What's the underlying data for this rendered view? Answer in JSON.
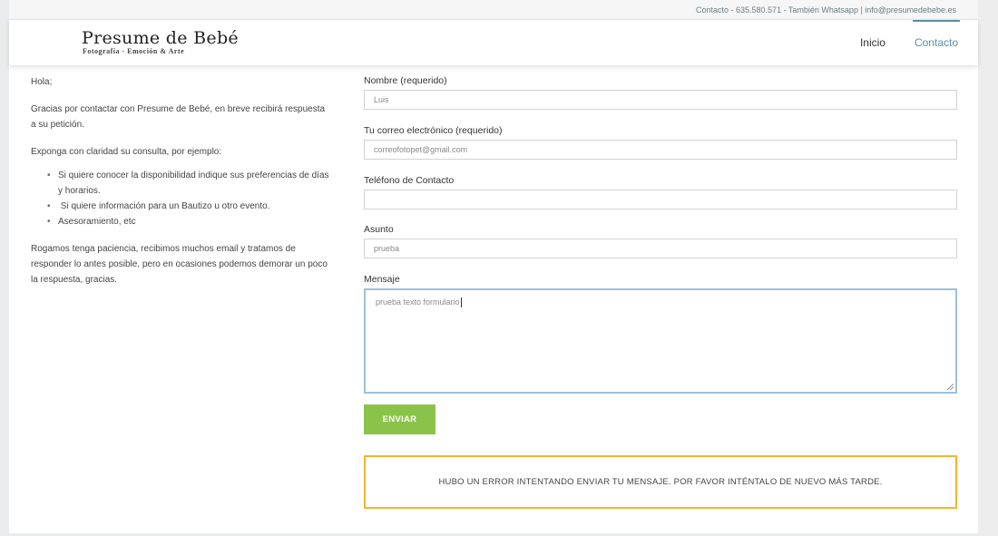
{
  "topbar": {
    "text": "Contacto - 635.580.571 - También Whatsapp  |  info@presumedebebe.es"
  },
  "header": {
    "logo_title": "Presume de Bebé",
    "logo_subtitle": "Fotografía - Emoción & Arte",
    "nav": [
      {
        "label": "Inicio",
        "active": false
      },
      {
        "label": "Contacto",
        "active": true
      }
    ]
  },
  "intro": {
    "greeting": "Hola;",
    "thanks": "Gracias por contactar con Presume de Bebé, en breve recibirá respuesta a su petición.",
    "instruction": "Exponga con claridad su consulta, por ejemplo:",
    "bullets": [
      "Si quiere conocer la disponibilidad indique sus preferencias de días y horarios.",
      " Si quiere información para un Bautizo u otro evento.",
      "Asesoramiento, etc"
    ],
    "closing": "Rogamos tenga paciencia, recibimos muchos email y tratamos de responder lo antes posible, pero en ocasiones podemos demorar un poco la respuesta, gracias."
  },
  "form": {
    "name_label": "Nombre (requerido)",
    "name_value": "Luis",
    "email_label": "Tu correo electrónico (requerido)",
    "email_value": "correofotopet@gmail.com",
    "phone_label": "Teléfono de Contacto",
    "phone_value": "",
    "subject_label": "Asunto",
    "subject_value": "prueba",
    "message_label": "Mensaje",
    "message_value": "prueba texto formulario",
    "submit_label": "ENVIAR",
    "error_message": "HUBO UN ERROR INTENTANDO ENVIAR TU MENSAJE. POR FAVOR INTÉNTALO DE NUEVO MÁS TARDE."
  },
  "colors": {
    "accent": "#5a8fa3",
    "submit_button": "#8bc34a",
    "error_border": "#f2b52d",
    "focus_border": "#9ec0dc"
  }
}
